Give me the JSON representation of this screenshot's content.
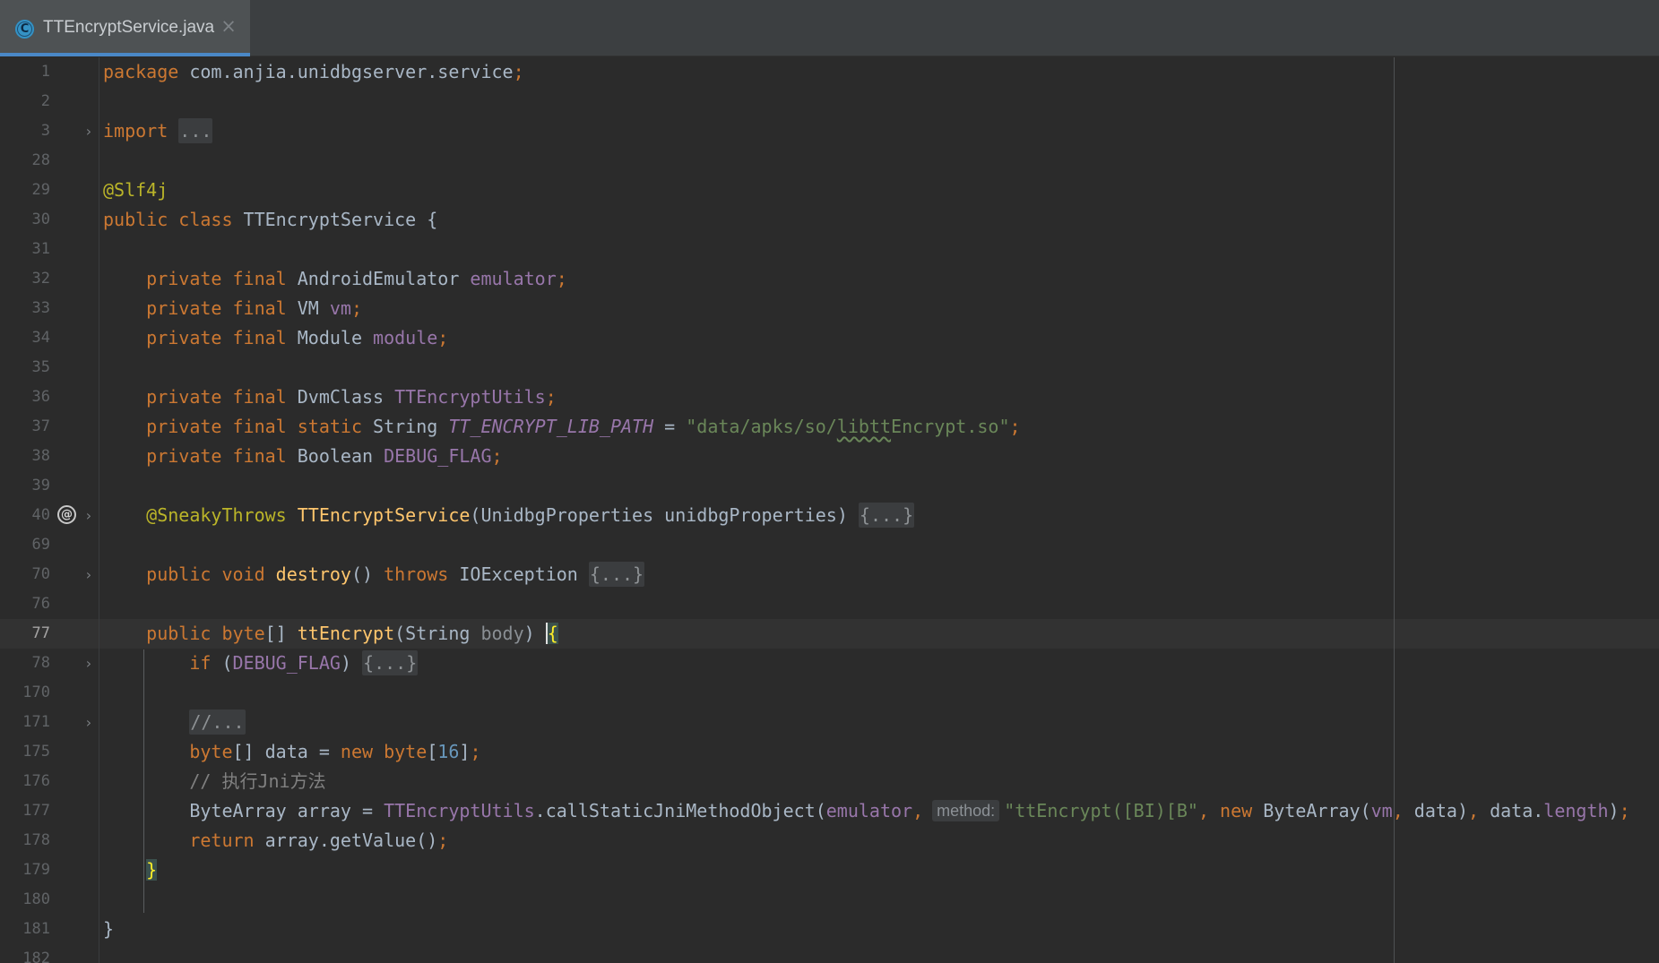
{
  "tab": {
    "icon_letter": "C",
    "title": "TTEncryptService.java",
    "close_glyph": "×"
  },
  "editor": {
    "current_line": "77",
    "lines": [
      {
        "n": "1",
        "text": "package com.anjia.unidbgserver.service;"
      },
      {
        "n": "2",
        "text": ""
      },
      {
        "n": "3",
        "text": "import ..."
      },
      {
        "n": "28",
        "text": ""
      },
      {
        "n": "29",
        "text": "@Slf4j"
      },
      {
        "n": "30",
        "text": "public class TTEncryptService {"
      },
      {
        "n": "31",
        "text": ""
      },
      {
        "n": "32",
        "text": "private final AndroidEmulator emulator;"
      },
      {
        "n": "33",
        "text": "private final VM vm;"
      },
      {
        "n": "34",
        "text": "private final Module module;"
      },
      {
        "n": "35",
        "text": ""
      },
      {
        "n": "36",
        "text": "private final DvmClass TTEncryptUtils;"
      },
      {
        "n": "37",
        "text": "private final static String TT_ENCRYPT_LIB_PATH = \"data/apks/so/libttEncrypt.so\";"
      },
      {
        "n": "38",
        "text": "private final Boolean DEBUG_FLAG;"
      },
      {
        "n": "39",
        "text": ""
      },
      {
        "n": "40",
        "text": "@SneakyThrows TTEncryptService(UnidbgProperties unidbgProperties) {...}"
      },
      {
        "n": "69",
        "text": ""
      },
      {
        "n": "70",
        "text": "public void destroy() throws IOException {...}"
      },
      {
        "n": "76",
        "text": ""
      },
      {
        "n": "77",
        "text": "public byte[] ttEncrypt(String body) {"
      },
      {
        "n": "78",
        "text": "if (DEBUG_FLAG) {...}"
      },
      {
        "n": "170",
        "text": ""
      },
      {
        "n": "171",
        "text": "//..."
      },
      {
        "n": "175",
        "text": "byte[] data = new byte[16];"
      },
      {
        "n": "176",
        "text": "// 执行Jni方法"
      },
      {
        "n": "177",
        "text": "ByteArray array = TTEncryptUtils.callStaticJniMethodObject(emulator, method: \"ttEncrypt([BI)[B\", new ByteArray(vm, data), data.length);"
      },
      {
        "n": "178",
        "text": "return array.getValue();"
      },
      {
        "n": "179",
        "text": "}"
      },
      {
        "n": "180",
        "text": ""
      },
      {
        "n": "181",
        "text": "}"
      },
      {
        "n": "182",
        "text": ""
      }
    ]
  },
  "colors": {
    "background": "#2b2b2b",
    "keyword": "#cc7832",
    "annotation": "#bbb529",
    "field": "#9876aa",
    "string": "#6a8759",
    "number": "#6897bb",
    "method": "#ffc66d",
    "comment": "#808080",
    "text": "#a9b7c6",
    "tab_accent": "#4a88c7"
  },
  "icons": {
    "tab_icon": "java-class-icon",
    "fold": "chevron-right-icon",
    "gutter_marker": "at-sign-implementation-icon"
  }
}
